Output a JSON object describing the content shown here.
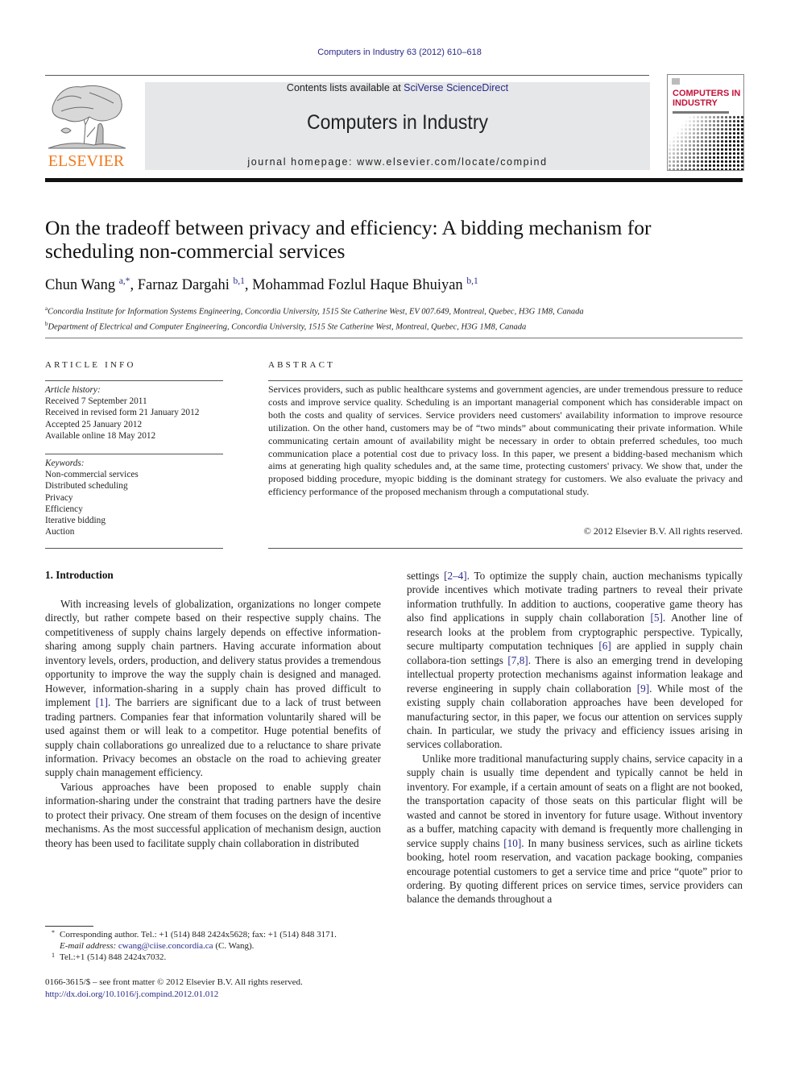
{
  "header": {
    "journal_reference": "Computers in Industry 63 (2012) 610–618",
    "contents_prefix": "Contents lists available at ",
    "contents_link": "SciVerse ScienceDirect",
    "journal_title": "Computers in Industry",
    "homepage": "journal homepage: www.elsevier.com/locate/compind",
    "publisher_logo": "ELSEVIER",
    "cover_title_line1": "COMPUTERS IN",
    "cover_title_line2": "INDUSTRY",
    "colors": {
      "link": "#2a2a88",
      "publisher_orange": "#f07a20",
      "cover_red": "#c4123a",
      "box_bg": "#e6e7e8"
    }
  },
  "article": {
    "title": "On the tradeoff between privacy and efficiency: A bidding mechanism for scheduling non-commercial services",
    "authors": [
      {
        "name": "Chun Wang",
        "sup": "a,*",
        "sep": ", "
      },
      {
        "name": "Farnaz Dargahi",
        "sup": "b,1",
        "sep": ", "
      },
      {
        "name": "Mohammad Fozlul Haque Bhuiyan",
        "sup": "b,1",
        "sep": ""
      }
    ],
    "affiliations": [
      {
        "mark": "a",
        "text": "Concordia Institute for Information Systems Engineering, Concordia University, 1515 Ste Catherine West, EV 007.649, Montreal, Quebec, H3G 1M8, Canada"
      },
      {
        "mark": "b",
        "text": "Department of Electrical and Computer Engineering, Concordia University, 1515 Ste Catherine West, Montreal, Quebec, H3G 1M8, Canada"
      }
    ]
  },
  "article_info": {
    "heading": "ARTICLE INFO",
    "history_label": "Article history:",
    "history": [
      "Received 7 September 2011",
      "Received in revised form 21 January 2012",
      "Accepted 25 January 2012",
      "Available online 18 May 2012"
    ],
    "keywords_label": "Keywords:",
    "keywords": [
      "Non-commercial services",
      "Distributed scheduling",
      "Privacy",
      "Efficiency",
      "Iterative bidding",
      "Auction"
    ]
  },
  "abstract": {
    "heading": "ABSTRACT",
    "text": "Services providers, such as public healthcare systems and government agencies, are under tremendous pressure to reduce costs and improve service quality. Scheduling is an important managerial component which has considerable impact on both the costs and quality of services. Service providers need customers' availability information to improve resource utilization. On the other hand, customers may be of “two minds” about communicating their private information. While communicating certain amount of availability might be necessary in order to obtain preferred schedules, too much communication place a potential cost due to privacy loss. In this paper, we present a bidding-based mechanism which aims at generating high quality schedules and, at the same time, protecting customers' privacy. We show that, under the proposed bidding procedure, myopic bidding is the dominant strategy for customers. We also evaluate the privacy and efficiency performance of the proposed mechanism through a computational study.",
    "copyright": "© 2012 Elsevier B.V. All rights reserved."
  },
  "body": {
    "section_heading": "1.  Introduction",
    "left_paragraphs": [
      [
        {
          "t": "With increasing levels of globalization, organizations no longer compete directly, but rather compete based on their respective supply chains. The competitiveness of supply chains largely depends on effective information-sharing among supply chain partners. Having accurate information about inventory levels, orders, production, and delivery status provides a tremendous opportunity to improve the way the supply chain is designed and managed. However, information-sharing in a supply chain has proved difficult to implement "
        },
        {
          "ref": "[1]"
        },
        {
          "t": ". The barriers are significant due to a lack of trust between trading partners. Companies fear that information voluntarily shared will be used against them or will leak to a competitor. Huge potential benefits of supply chain collaborations go unrealized due to a reluctance to share private information. Privacy becomes an obstacle on the road to achieving greater supply chain management efficiency."
        }
      ],
      [
        {
          "t": "Various approaches have been proposed to enable supply chain information-sharing under the constraint that trading partners have the desire to protect their privacy. One stream of them focuses on the design of incentive mechanisms. As the most successful application of mechanism design, auction theory has been used to facilitate supply chain collaboration in distributed"
        }
      ]
    ],
    "right_paragraphs": [
      [
        {
          "t": "settings "
        },
        {
          "ref": "[2–4]"
        },
        {
          "t": ". To optimize the supply chain, auction mechanisms typically provide incentives which motivate trading partners to reveal their private information truthfully. In addition to auctions, cooperative game theory has also find applications in supply chain collaboration "
        },
        {
          "ref": "[5]"
        },
        {
          "t": ". Another line of research looks at the problem from cryptographic perspective. Typically, secure multiparty computation techniques "
        },
        {
          "ref": "[6]"
        },
        {
          "t": " are applied in supply chain collabora-tion settings "
        },
        {
          "ref": "[7,8]"
        },
        {
          "t": ". There is also an emerging trend in developing intellectual property protection mechanisms against information leakage and reverse engineering in supply chain collaboration "
        },
        {
          "ref": "[9]"
        },
        {
          "t": ". While most of the existing supply chain collaboration approaches have been developed for manufacturing sector, in this paper, we focus our attention on services supply chain. In particular, we study the privacy and efficiency issues arising in services collaboration."
        }
      ],
      [
        {
          "t": "Unlike more traditional manufacturing supply chains, service capacity in a supply chain is usually time dependent and typically cannot be held in inventory. For example, if a certain amount of seats on a flight are not booked, the transportation capacity of those seats on this particular flight will be wasted and cannot be stored in inventory for future usage. Without inventory as a buffer, matching capacity with demand is frequently more challenging in service supply chains "
        },
        {
          "ref": "[10]"
        },
        {
          "t": ". In many business services, such as airline tickets booking, hotel room reservation, and vacation package booking, companies encourage potential customers to get a service time and price “quote” prior to ordering. By quoting different prices on service times, service providers can balance the demands throughout a"
        }
      ]
    ]
  },
  "footnotes": {
    "corresponding_mark": "*",
    "corresponding_text": "Corresponding author. Tel.: +1 (514) 848 2424x5628; fax: +1 (514) 848 3171.",
    "email_label": "E-mail address:",
    "email": "cwang@ciise.concordia.ca",
    "email_suffix": " (C. Wang).",
    "note1_mark": "1",
    "note1_text": "Tel.:+1 (514) 848 2424x7032."
  },
  "front_matter": {
    "issn_line": "0166-3615/$ – see front matter © 2012 Elsevier B.V. All rights reserved.",
    "doi": "http://dx.doi.org/10.1016/j.compind.2012.01.012"
  }
}
